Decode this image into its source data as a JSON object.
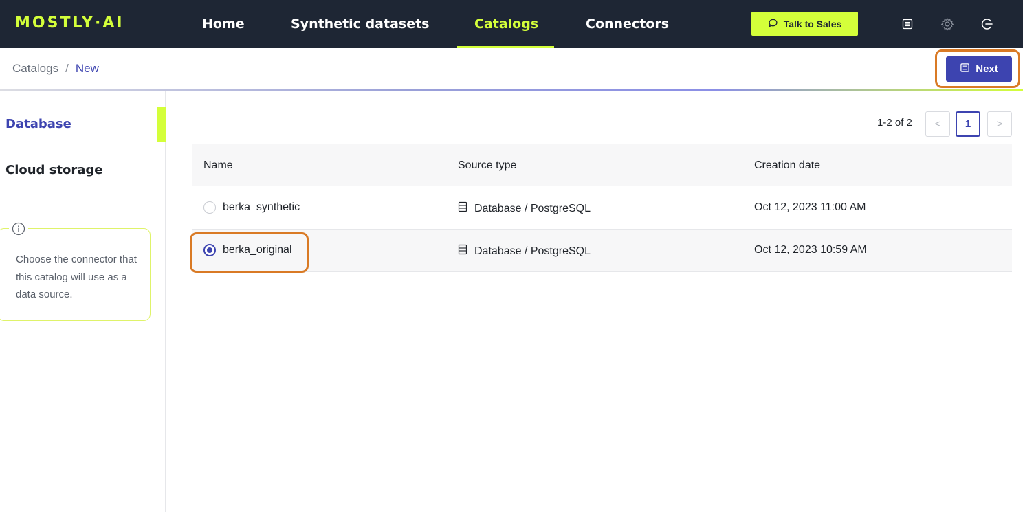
{
  "app": {
    "logo": "MOSTLY·AI"
  },
  "nav": {
    "items": [
      {
        "label": "Home",
        "active": false
      },
      {
        "label": "Synthetic datasets",
        "active": false
      },
      {
        "label": "Catalogs",
        "active": true
      },
      {
        "label": "Connectors",
        "active": false
      }
    ],
    "talk_to_sales": "Talk to Sales",
    "icons": [
      "docs-icon",
      "settings-icon",
      "logout-icon"
    ]
  },
  "breadcrumb": {
    "parent": "Catalogs",
    "separator": "/",
    "current": "New"
  },
  "actions": {
    "next_label": "Next"
  },
  "sidebar": {
    "items": [
      {
        "label": "Database",
        "active": true
      },
      {
        "label": "Cloud storage",
        "active": false
      }
    ],
    "info_text": "Choose the connector that this catalog will use as a data source."
  },
  "pagination": {
    "summary": "1-2 of 2",
    "prev": "<",
    "current_page": "1",
    "next": ">"
  },
  "table": {
    "columns": [
      "Name",
      "Source type",
      "Creation date"
    ],
    "rows": [
      {
        "name": "berka_synthetic",
        "source_type": "Database / PostgreSQL",
        "creation_date": "Oct 12, 2023 11:00 AM",
        "selected": false
      },
      {
        "name": "berka_original",
        "source_type": "Database / PostgreSQL",
        "creation_date": "Oct 12, 2023 10:59 AM",
        "selected": true
      }
    ]
  },
  "colors": {
    "topbar": "#1e2634",
    "accent_lime": "#d4ff3a",
    "primary": "#3d44b0",
    "highlight_orange": "#d97a25"
  }
}
